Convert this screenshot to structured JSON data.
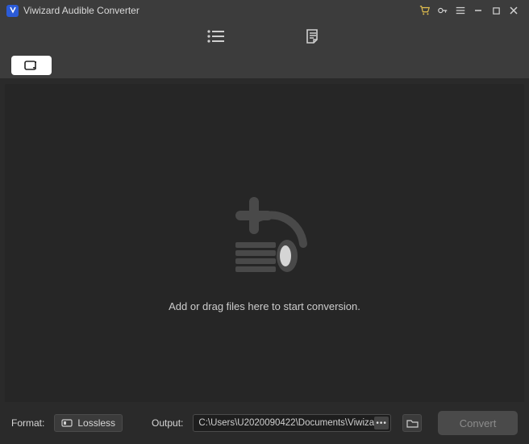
{
  "titlebar": {
    "title": "Viwizard Audible Converter"
  },
  "main": {
    "drop_text": "Add or drag files here to start conversion."
  },
  "footer": {
    "format_label": "Format:",
    "format_value": "Lossless",
    "output_label": "Output:",
    "output_path": "C:\\Users\\U2020090422\\Documents\\Viwiza",
    "convert_label": "Convert"
  }
}
